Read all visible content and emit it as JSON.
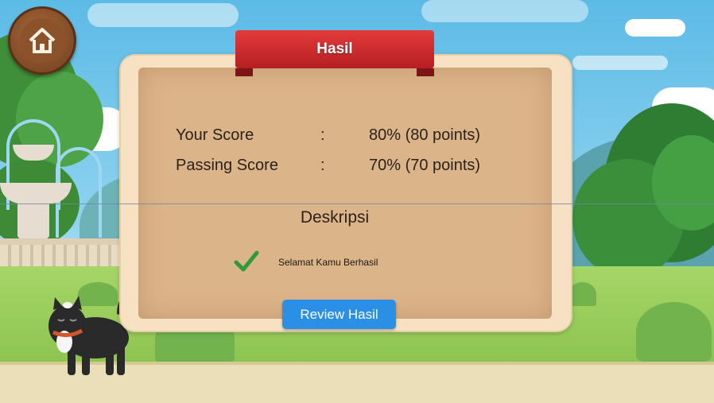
{
  "header": {
    "title": "Hasil"
  },
  "nav": {
    "home_icon": "home-icon"
  },
  "results": {
    "your_score_label": "Your Score",
    "your_score_value": "80% (80 points)",
    "passing_score_label": "Passing Score",
    "passing_score_value": "70% (70 points)",
    "separator": ":"
  },
  "description": {
    "title": "Deskripsi",
    "status_icon": "check-icon",
    "message": "Selamat Kamu Berhasil"
  },
  "actions": {
    "review_label": "Review Hasil"
  },
  "colors": {
    "ribbon": "#d42a2e",
    "button": "#2c8fe6",
    "check": "#2e9b35",
    "paper": "#dcb489"
  }
}
